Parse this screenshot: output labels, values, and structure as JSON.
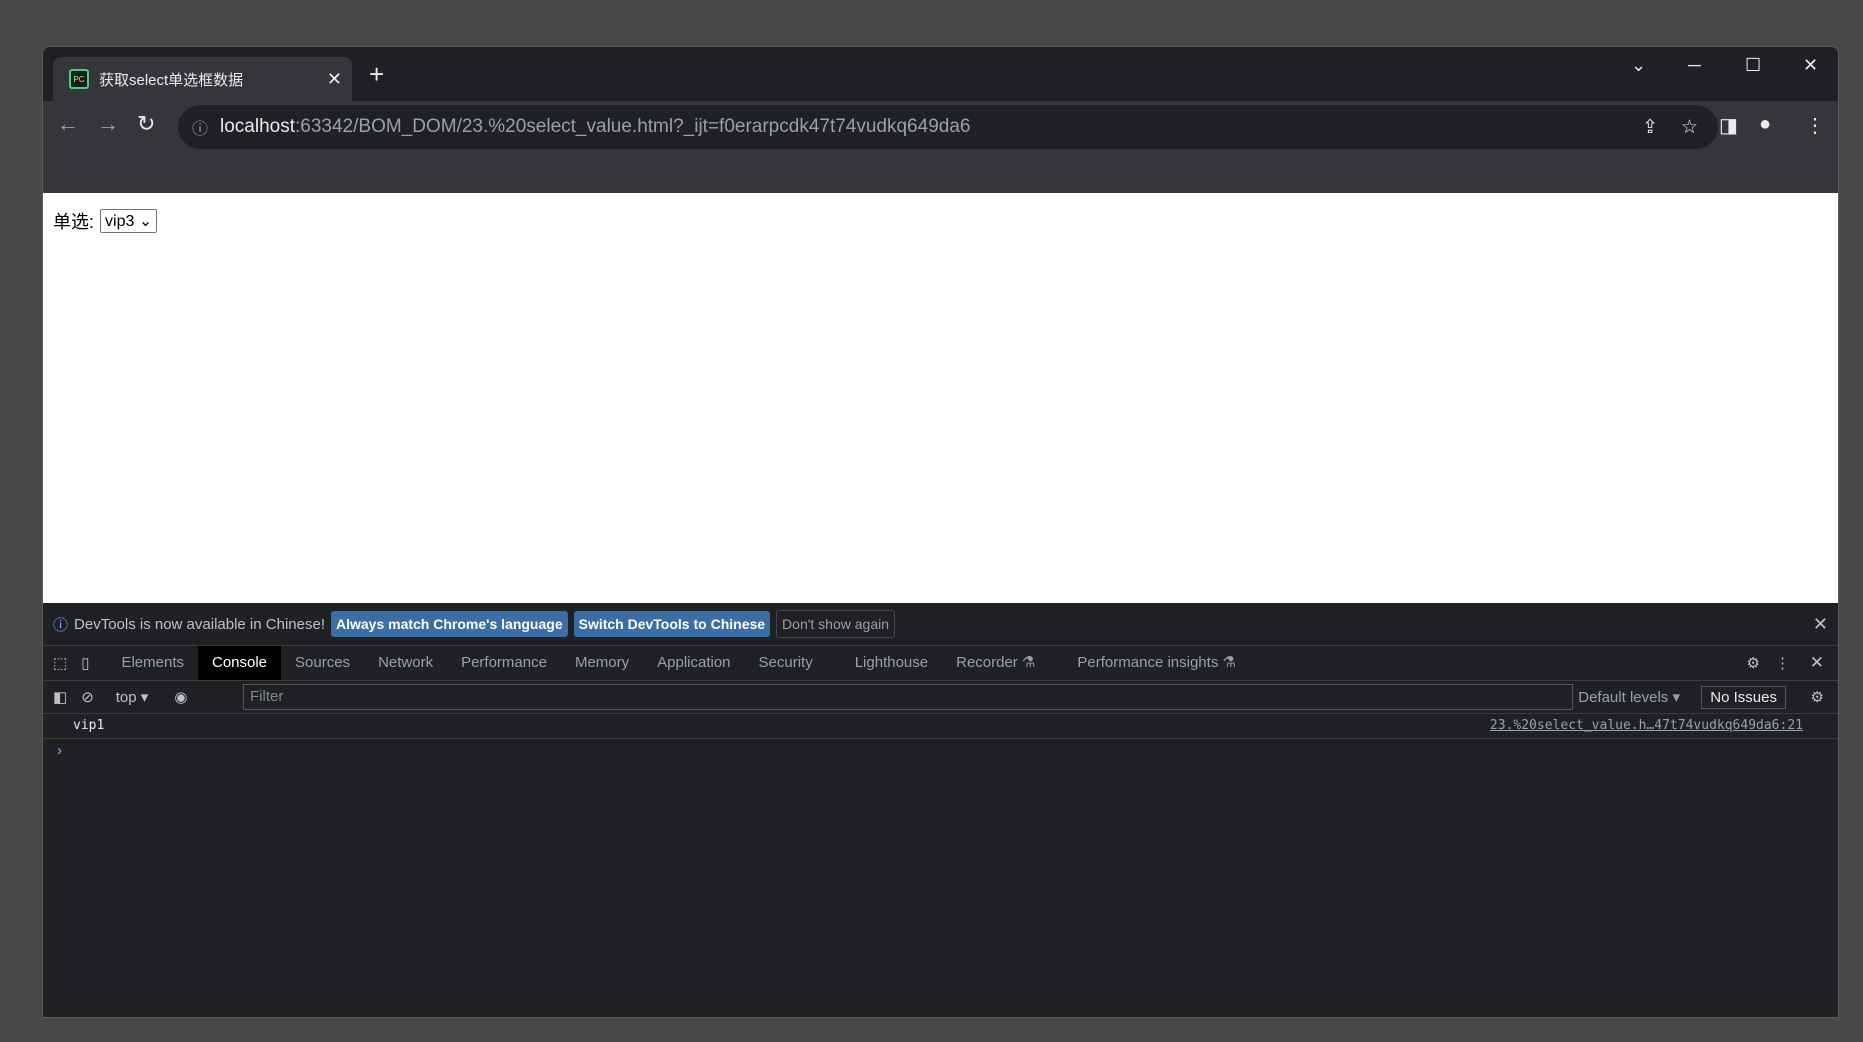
{
  "browser": {
    "tab_title": "获取select单选框数据",
    "url_host": "localhost",
    "url_rest": ":63342/BOM_DOM/23.%20select_value.html?_ijt=f0erarpcdk47t74vudkq649da6"
  },
  "page": {
    "label": "单选:",
    "select_value": "vip3"
  },
  "devtools": {
    "infobar": {
      "message": "DevTools is now available in Chinese!",
      "btn_match": "Always match Chrome's language",
      "btn_switch": "Switch DevTools to Chinese",
      "btn_dismiss": "Don't show again"
    },
    "tabs": [
      "Elements",
      "Console",
      "Sources",
      "Network",
      "Performance",
      "Memory",
      "Application",
      "Security",
      "Lighthouse",
      "Recorder ⚗",
      "Performance insights ⚗"
    ],
    "context": "top",
    "filter_placeholder": "Filter",
    "levels": "Default levels ▾",
    "issues": "No Issues",
    "messages": [
      {
        "text": "vip1",
        "source": "23.%20select_value.h…47t74vudkq649da6:21"
      }
    ]
  }
}
